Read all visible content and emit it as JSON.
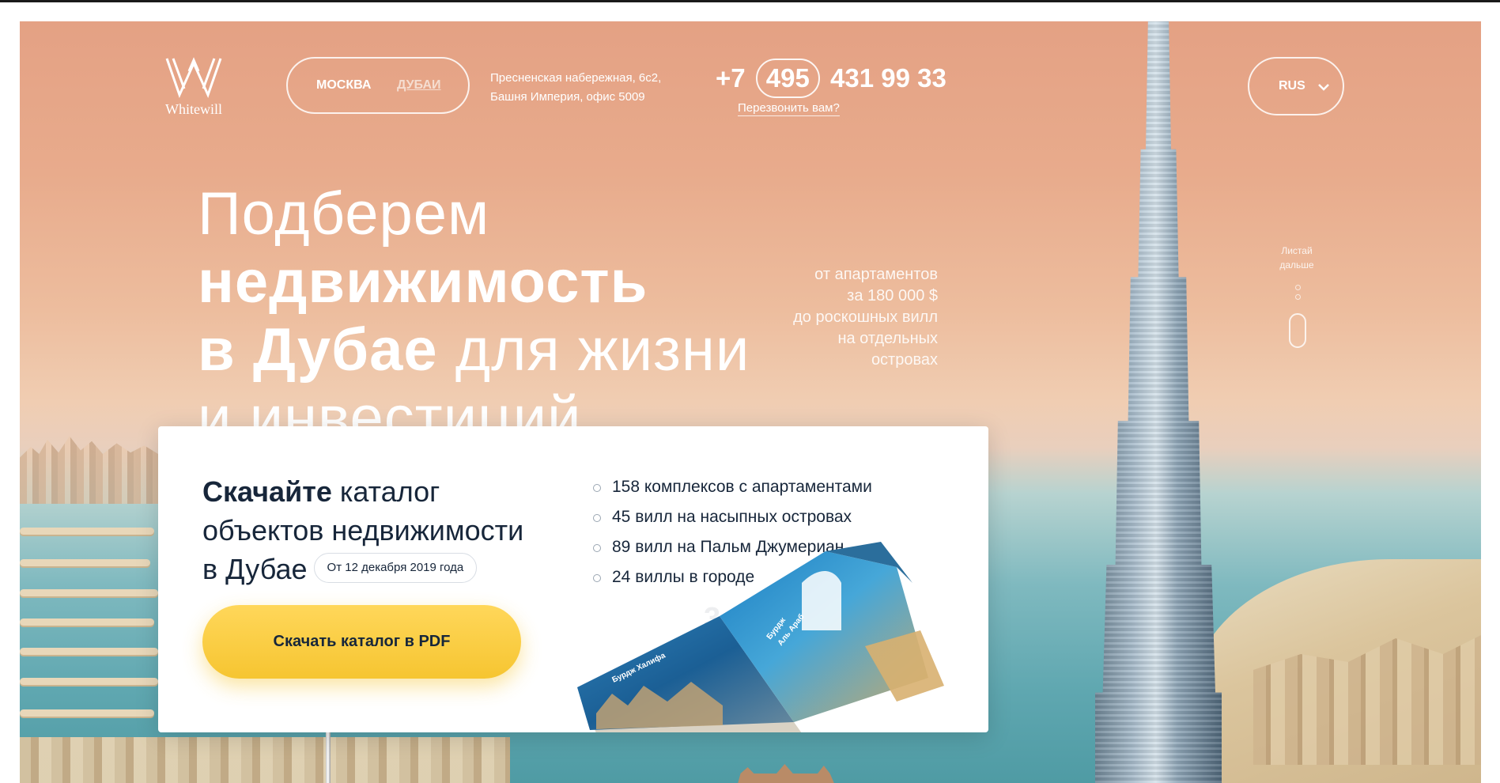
{
  "header": {
    "logo_text": "Whitewill",
    "cities": [
      "МОСКВА",
      "ДУБАИ"
    ],
    "address_line1": "Пресненская набережная, 6с2,",
    "address_line2": "Башня Империя, офис 5009",
    "phone_prefix": "+7",
    "phone_code": "495",
    "phone_number": "431 99 33",
    "callback_label": "Перезвонить вам?",
    "language": "RUS"
  },
  "hero": {
    "title_part1": "Подберем ",
    "title_bold1": "недвижимость",
    "title_bold2": "в Дубае",
    "title_part2": " для жизни",
    "title_part3": "и инвестиций",
    "range_lines": [
      "от апартаментов",
      "за 180 000 $",
      "до роскошных вилл",
      "на отдельных",
      "островах"
    ],
    "scroll_hint_line1": "Листай",
    "scroll_hint_line2": "дальше"
  },
  "catalog": {
    "title_bold": "Скачайте",
    "title_rest1": " каталог",
    "title_rest2": "объектов недвижимости",
    "title_rest3": "в Дубае",
    "date_chip": "От 12 декабря 2019 года",
    "download_button": "Скачать каталог в PDF",
    "file_size": "3.8 Мб",
    "stats": [
      "158 комплексов с апартаментами",
      "45 вилл на насыпных островах",
      "89 вилл на Пальм Джумериан",
      "24 виллы в городе"
    ],
    "magazine_label_left": "Бурдж Халифа",
    "magazine_label_right1": "Бурдж",
    "magazine_label_right2": "Аль Араб"
  },
  "colors": {
    "accent_yellow": "#f6c531",
    "text_dark": "#17263a",
    "sky_peach": "#e4a184"
  },
  "icons": [
    "whitewill-logo-icon",
    "chevron-down-icon",
    "mouse-scroll-icon"
  ]
}
